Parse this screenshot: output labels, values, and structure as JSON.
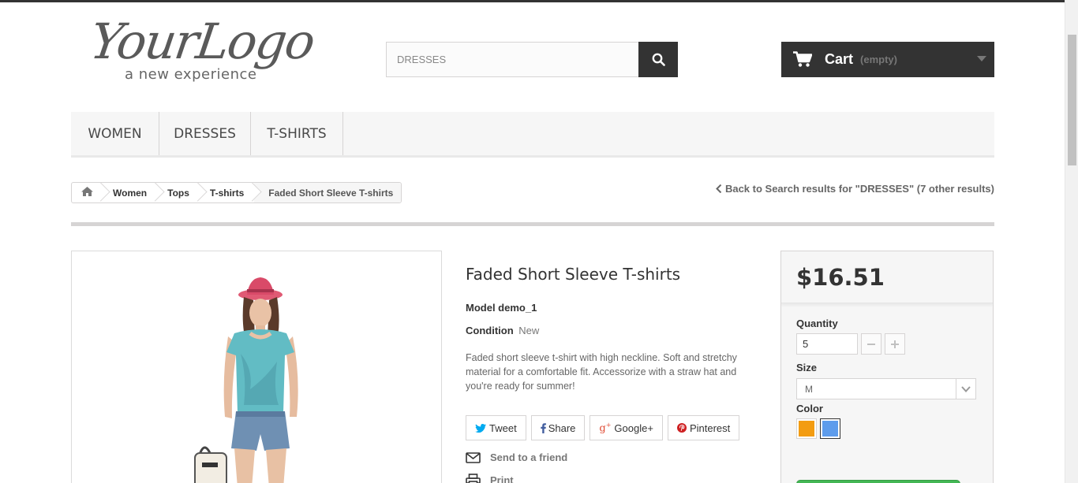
{
  "header": {
    "logo_main": "YourLogo",
    "logo_sub": "a new experience",
    "search_placeholder": "DRESSES",
    "cart_label": "Cart",
    "cart_status": "(empty)"
  },
  "menu": {
    "items": [
      {
        "label": "WOMEN"
      },
      {
        "label": "DRESSES"
      },
      {
        "label": "T-SHIRTS"
      }
    ]
  },
  "breadcrumb": {
    "items": [
      "Women",
      "Tops",
      "T-shirts"
    ],
    "current": "Faded Short Sleeve T-shirts"
  },
  "back_link": "Back to Search results for \"DRESSES\" (7 other results)",
  "product": {
    "title": "Faded Short Sleeve T-shirts",
    "model": "Model demo_1",
    "condition_label": "Condition",
    "condition_value": "New",
    "description": "Faded short sleeve t-shirt with high neckline. Soft and stretchy material for a comfortable fit. Accessorize with a straw hat and you're ready for summer!",
    "share": {
      "tweet": "Tweet",
      "share": "Share",
      "google": "Google+",
      "pinterest": "Pinterest"
    },
    "send_to_friend": "Send to a friend",
    "print": "Print"
  },
  "buy": {
    "price": "$16.51",
    "quantity_label": "Quantity",
    "quantity_value": "5",
    "size_label": "Size",
    "size_value": "M",
    "color_label": "Color",
    "colors": [
      "#f39c11",
      "#5d9cec"
    ],
    "selected_color": 1
  },
  "colors": {
    "dark": "#333333",
    "twitter": "#00aaf0",
    "facebook": "#435f9f",
    "google": "#e04b34",
    "pinterest": "#ce1f21"
  }
}
